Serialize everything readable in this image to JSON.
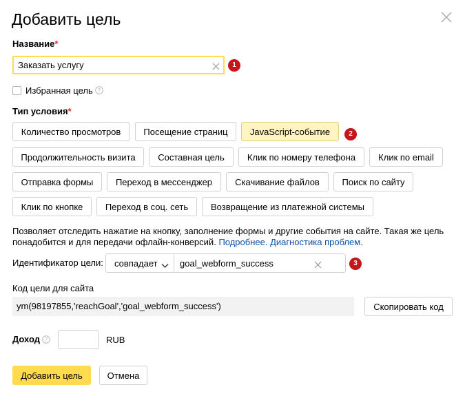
{
  "dialog": {
    "title": "Добавить цель",
    "close_icon": "close-icon"
  },
  "name": {
    "label": "Название",
    "required_mark": "*",
    "value": "Заказать услугу",
    "badge": "1"
  },
  "favorite": {
    "label": "Избранная цель",
    "checked": false,
    "help_icon": "question-circle-icon"
  },
  "condition": {
    "label": "Тип условия",
    "required_mark": "*",
    "selected": "JavaScript-событие",
    "badge": "2",
    "types": [
      "Количество просмотров",
      "Посещение страниц",
      "JavaScript-событие",
      "Продолжительность визита",
      "Составная цель",
      "Клик по номеру телефона",
      "Клик по email",
      "Отправка формы",
      "Переход в мессенджер",
      "Скачивание файлов",
      "Поиск по сайту",
      "Клик по кнопке",
      "Переход в соц. сеть",
      "Возвращение из платежной системы"
    ]
  },
  "description": {
    "text": "Позволяет отследить нажатие на кнопку, заполнение формы и другие события на сайте. Такая же цель понадобится и для передачи офлайн-конверсий.",
    "link_more": "Подробнее.",
    "link_diag": "Диагностика проблем."
  },
  "identifier": {
    "label": "Идентификатор цели:",
    "match_value": "совпадает",
    "value": "goal_webform_success",
    "badge": "3"
  },
  "code": {
    "label": "Код цели для сайта",
    "snippet": "ym(98197855,'reachGoal','goal_webform_success')",
    "copy_label": "Скопировать код"
  },
  "income": {
    "label": "Доход",
    "value": "",
    "currency": "RUB"
  },
  "footer": {
    "submit_label": "Добавить цель",
    "cancel_label": "Отмена"
  },
  "colors": {
    "accent": "#ffdb4d",
    "selected_bg": "#fff4c2",
    "badge": "#c5161b",
    "link": "#0a51a8",
    "required": "#e62e2e"
  }
}
